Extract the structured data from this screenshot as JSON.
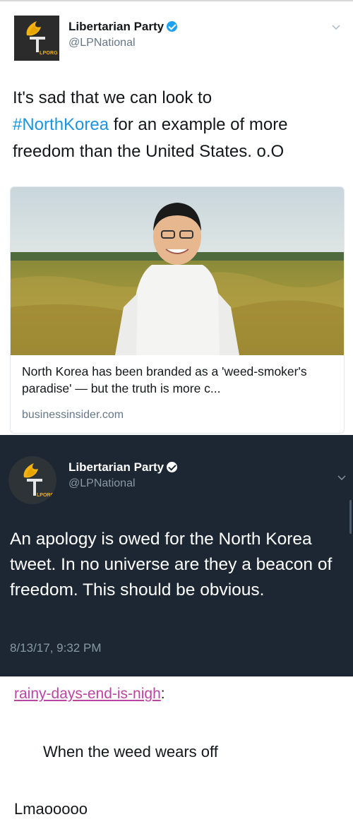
{
  "tweet1": {
    "avatar_icon": "libertarian-torch-icon",
    "avatar_text": "LPORG",
    "name": "Libertarian Party",
    "handle": "@LPNational",
    "verified_icon": "verified-badge-icon",
    "menu_icon": "chevron-down-icon",
    "text_before": "It's sad that we can look to",
    "hashtag": "#NorthKorea",
    "text_after": " for an example of more freedom than the United States. o.O",
    "card": {
      "image_icon": "photo-thumbnail",
      "title": "North Korea has been branded as a 'weed-smoker's paradise' — but the truth is more c...",
      "domain": "businessinsider.com"
    }
  },
  "tweet2": {
    "avatar_icon": "libertarian-torch-icon",
    "avatar_text": "LPORG",
    "name": "Libertarian Party",
    "handle": "@LPNational",
    "verified_icon": "verified-badge-icon",
    "menu_icon": "chevron-down-icon",
    "text": "An apology is owed for the North Korea tweet. In no universe are they a beacon of freedom. This should be obvious.",
    "timestamp": "8/13/17, 9:32 PM"
  },
  "tumblr": {
    "username": "rainy-days-end-is-nigh",
    "username_suffix": ":",
    "quote": "When the weed wears off",
    "reply": "Lmaooooo"
  },
  "colors": {
    "link_blue": "#1b95e0",
    "tumblr_pink": "#bd44a3",
    "dark_bg": "#1c2733",
    "verified_blue": "#1da1f2",
    "torch_gold": "#f2b313"
  }
}
